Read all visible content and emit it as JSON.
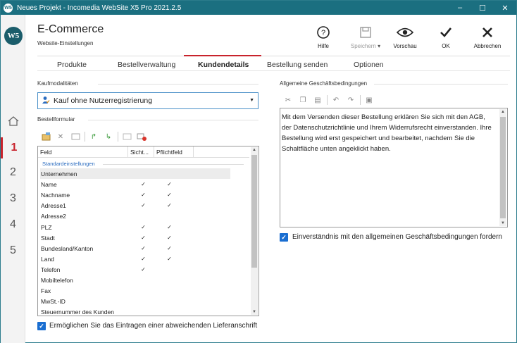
{
  "window": {
    "title": "Neues Projekt - Incomedia WebSite X5 Pro 2021.2.5",
    "app_icon_text": "W5",
    "minimize": "–",
    "maximize": "☐",
    "close": "✕"
  },
  "rail": {
    "logo_text": "W5",
    "home_icon": "home-icon",
    "steps": [
      "1",
      "2",
      "3",
      "4",
      "5"
    ],
    "active_step": "1"
  },
  "header": {
    "title": "E-Commerce",
    "subtitle": "Website-Einstellungen"
  },
  "toolbar": {
    "help_label": "Hilfe",
    "save_label": "Speichern",
    "save_caret": "▾",
    "preview_label": "Vorschau",
    "ok_label": "OK",
    "cancel_label": "Abbrechen"
  },
  "tabs": [
    "Produkte",
    "Bestellverwaltung",
    "Kundendetails",
    "Bestellung senden",
    "Optionen"
  ],
  "active_tab": "Kundendetails",
  "left": {
    "kaufmodalitaeten_label": "Kaufmodalitäten",
    "purchase_mode_value": "Kauf ohne Nutzerregistrierung",
    "bestellformular_label": "Bestellformular",
    "table": {
      "headers": [
        "Feld",
        "Sicht...",
        "Pflichtfeld"
      ],
      "group_label": "Standardeinstellungen",
      "rows": [
        {
          "name": "Unternehmen",
          "visible": "",
          "required": ""
        },
        {
          "name": "Name",
          "visible": "✓",
          "required": "✓"
        },
        {
          "name": "Nachname",
          "visible": "✓",
          "required": "✓"
        },
        {
          "name": "Adresse1",
          "visible": "✓",
          "required": "✓"
        },
        {
          "name": "Adresse2",
          "visible": "",
          "required": ""
        },
        {
          "name": "PLZ",
          "visible": "✓",
          "required": "✓"
        },
        {
          "name": "Stadt",
          "visible": "✓",
          "required": "✓"
        },
        {
          "name": "Bundesland/Kanton",
          "visible": "✓",
          "required": "✓"
        },
        {
          "name": "Land",
          "visible": "✓",
          "required": "✓"
        },
        {
          "name": "Telefon",
          "visible": "✓",
          "required": ""
        },
        {
          "name": "Mobiltelefon",
          "visible": "",
          "required": ""
        },
        {
          "name": "Fax",
          "visible": "",
          "required": ""
        },
        {
          "name": "MwSt.-ID",
          "visible": "",
          "required": ""
        },
        {
          "name": "Steuernummer des Kunden",
          "visible": "",
          "required": ""
        }
      ]
    },
    "alt_shipping_checkbox_label": "Ermöglichen Sie das Eintragen einer abweichenden Lieferanschrift",
    "alt_shipping_checked": true
  },
  "right": {
    "agb_label": "Allgemeine Geschäftsbedingungen",
    "agb_text": "Mit dem Versenden dieser Bestellung erklären Sie sich mit den AGB, der Datenschutzrichtlinie und Ihrem Widerrufsrecht einverstanden. Ihre Bestellung wird erst gespeichert und bearbeitet, nachdem Sie die Schaltfläche unten angeklickt haben.",
    "agb_checkbox_label": "Einverständnis mit den allgemeinen Geschäftsbedingungen fordern",
    "agb_checked": true
  },
  "colors": {
    "titlebar": "#1b6f80",
    "accent_red": "#c8232c",
    "checkbox_blue": "#1a6ed1"
  }
}
